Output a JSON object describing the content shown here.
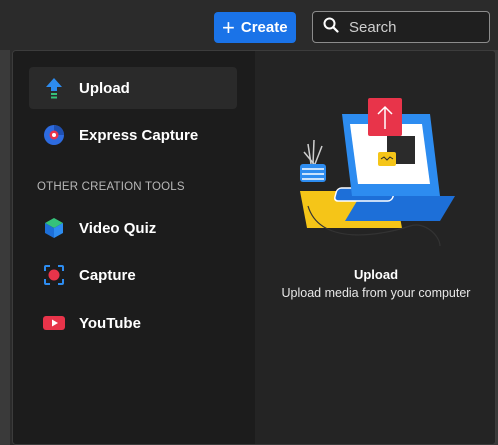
{
  "header": {
    "create_label": "Create",
    "search_placeholder": "Search"
  },
  "menu": {
    "items_top": [
      {
        "label": "Upload",
        "icon": "upload-arrow-icon",
        "active": true
      },
      {
        "label": "Express Capture",
        "icon": "express-capture-icon",
        "active": false
      }
    ],
    "section_label": "OTHER CREATION TOOLS",
    "items_other": [
      {
        "label": "Video Quiz",
        "icon": "video-quiz-cube-icon"
      },
      {
        "label": "Capture",
        "icon": "capture-record-icon"
      },
      {
        "label": "YouTube",
        "icon": "youtube-icon"
      }
    ]
  },
  "preview": {
    "title": "Upload",
    "subtitle": "Upload media from your computer"
  },
  "colors": {
    "accent_blue": "#1a73e8",
    "upload_arrow_blue": "#2d8cf0",
    "upload_arrow_green": "#35c27a",
    "red": "#e8344a",
    "yellow": "#f5c518"
  }
}
